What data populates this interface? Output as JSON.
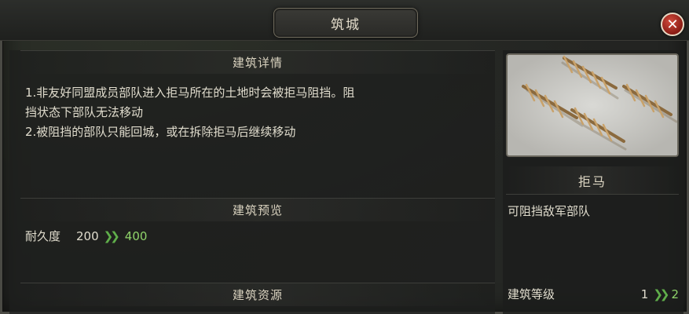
{
  "window": {
    "title": "筑城",
    "close_glyph": "✕"
  },
  "details": {
    "header": "建筑详情",
    "lines": [
      "1.非友好同盟成员部队进入拒马所在的土地时会被拒马阻挡。阻",
      "挡状态下部队无法移动",
      "2.被阻挡的部队只能回城，或在拆除拒马后继续移动"
    ]
  },
  "preview_section": {
    "header": "建筑预览",
    "stat_label": "耐久度",
    "stat_old": "200",
    "stat_new": "400",
    "arrow_icon": "double-chevron-right-icon"
  },
  "resources_section": {
    "header": "建筑资源"
  },
  "item": {
    "name": "拒马",
    "description": "可阻挡敌军部队",
    "level_label": "建筑等级",
    "level_old": "1",
    "level_new": "2"
  },
  "colors": {
    "accent_green": "#8fd36a",
    "close_red": "#b8322a"
  }
}
